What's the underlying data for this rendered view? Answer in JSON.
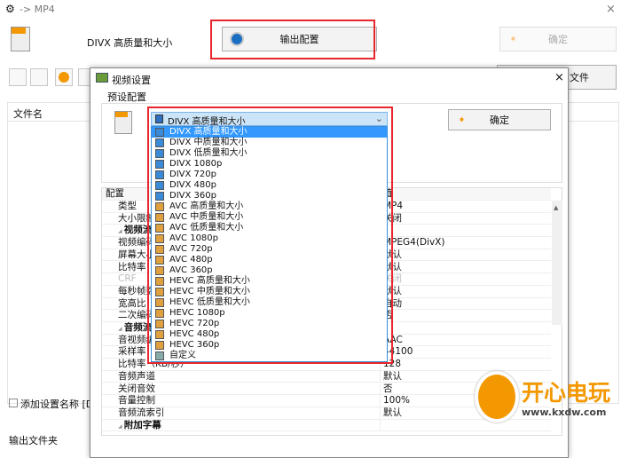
{
  "window": {
    "title": "-> MP4",
    "close": "×"
  },
  "header": {
    "preset": "DIVX 高质量和大小",
    "output_config": "输出配置",
    "ok": "确定",
    "file_button": "文件"
  },
  "list": {
    "filename_header": "文件名"
  },
  "footer": {
    "add_name": "添加设置名称 [DI",
    "output_folder": "输出文件夹"
  },
  "dialog": {
    "title": "视频设置",
    "close": "×",
    "group": "预设配置",
    "selected": "DIVX 高质量和大小",
    "ok": "确定",
    "options": [
      "DIVX 高质量和大小",
      "DIVX 中质量和大小",
      "DIVX 低质量和大小",
      "DIVX 1080p",
      "DIVX 720p",
      "DIVX 480p",
      "DIVX 360p",
      "AVC 高质量和大小",
      "AVC 中质量和大小",
      "AVC 低质量和大小",
      "AVC 1080p",
      "AVC 720p",
      "AVC 480p",
      "AVC 360p",
      "HEVC 高质量和大小",
      "HEVC 中质量和大小",
      "HEVC 低质量和大小",
      "HEVC 1080p",
      "HEVC 720p",
      "HEVC 480p",
      "HEVC 360p",
      "自定义"
    ],
    "grid_header": {
      "key": "配置",
      "value": "值"
    },
    "rows": [
      {
        "k": "类型",
        "v": "MP4"
      },
      {
        "k": "大小限制",
        "v": "关闭"
      },
      {
        "k": "视频流",
        "v": "",
        "sec": true
      },
      {
        "k": "视频编码",
        "v": "MPEG4(DivX)"
      },
      {
        "k": "屏幕大小",
        "v": "默认"
      },
      {
        "k": "比特率",
        "v": "默认"
      },
      {
        "k": "CRF",
        "v": "关闭",
        "grey": true
      },
      {
        "k": "每秒帧数",
        "v": "默认"
      },
      {
        "k": "宽高比",
        "v": "自动"
      },
      {
        "k": "二次编码",
        "v": "否"
      },
      {
        "k": "音频流",
        "v": "",
        "sec": true
      },
      {
        "k": "音视频编码",
        "v": "AAC"
      },
      {
        "k": "采样率",
        "v": "44100"
      },
      {
        "k": "比特率（KB/秒）",
        "v": "128"
      },
      {
        "k": "音频声道",
        "v": "默认"
      },
      {
        "k": "关闭音效",
        "v": "否"
      },
      {
        "k": "音量控制",
        "v": "100%"
      },
      {
        "k": "音频流索引",
        "v": "默认"
      },
      {
        "k": "附加字幕",
        "v": "",
        "sec": true
      }
    ]
  },
  "watermark": {
    "name": "开心电玩",
    "url": "www.kxdw.com"
  },
  "colors": {
    "highlight": "#e8262b",
    "selection": "#3399ff",
    "brand": "#f39800"
  }
}
